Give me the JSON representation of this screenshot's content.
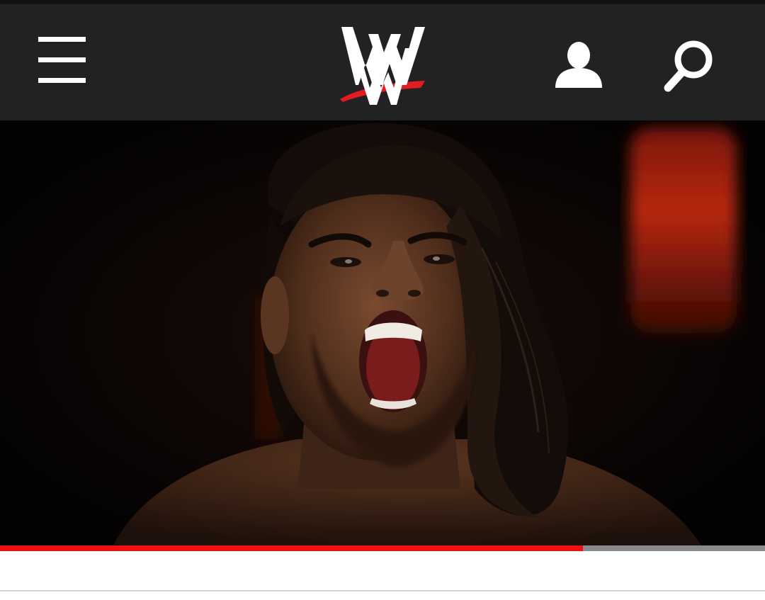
{
  "header": {
    "menu_icon": "hamburger-menu-icon",
    "logo": "wwe-logo",
    "account_icon": "user-account-icon",
    "search_icon": "search-icon",
    "background_color": "#222222"
  },
  "video": {
    "subject": "hero-video-frame",
    "progress_fraction": 0.762,
    "progress_color": "#ee1111"
  }
}
